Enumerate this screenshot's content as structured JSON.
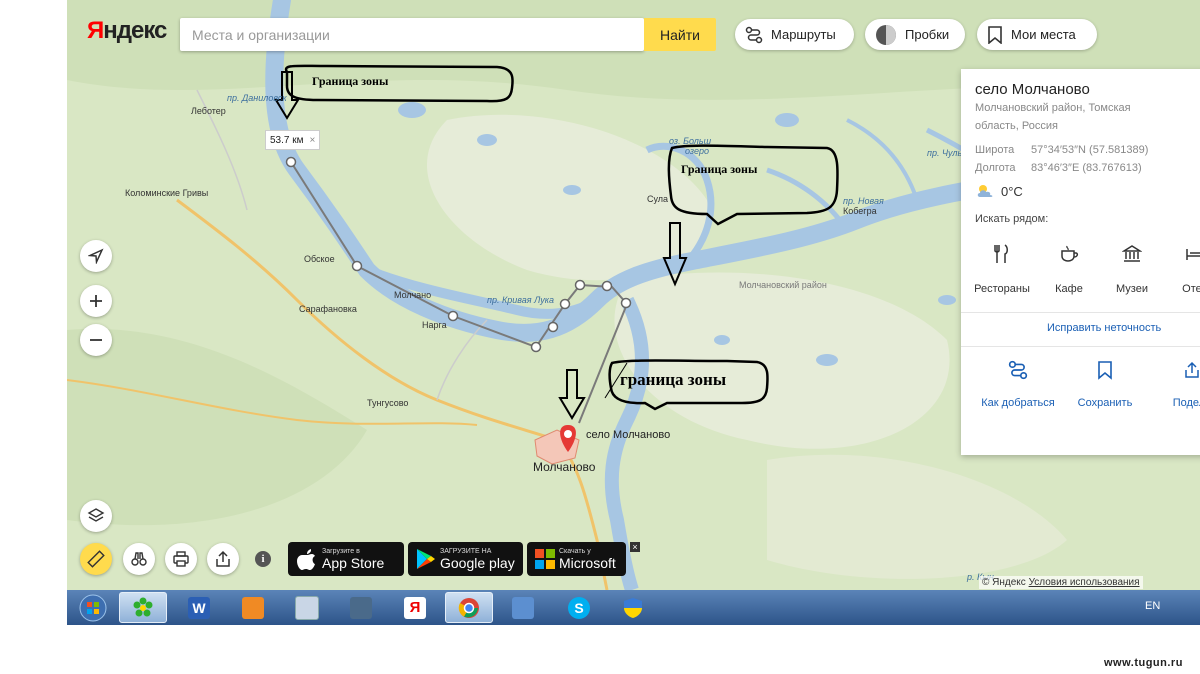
{
  "brand": {
    "logo_first": "Я",
    "logo_rest": "ндекс"
  },
  "search": {
    "placeholder": "Места и организации",
    "find_label": "Найти"
  },
  "top_buttons": {
    "routes": "Маршруты",
    "traffic": "Пробки",
    "my_places": "Мои места"
  },
  "place_card": {
    "title": "село Молчаново",
    "address": "Молчановский район, Томская область, Россия",
    "latitude_label": "Широта",
    "latitude_value": "57°34′53″N (57.581389)",
    "longitude_label": "Долгота",
    "longitude_value": "83°46′3″E (83.767613)",
    "weather": "0°C",
    "nearby_label": "Искать рядом:",
    "categories": [
      "Рестораны",
      "Кафе",
      "Музеи",
      "Отел"
    ],
    "fix_link": "Исправить неточность",
    "actions": [
      "Как добраться",
      "Сохранить",
      "Подели"
    ]
  },
  "map": {
    "distance_label": "53.7 км",
    "place_pin_label": "село Молчаново",
    "labels": {
      "lebotter": "Леботер",
      "kolominskie": "Коломинские Гривы",
      "obskoe": "Обское",
      "molchanovo_small": "Молчано",
      "narga": "Нарга",
      "sarafanovka": "Сарафановка",
      "tungusovo": "Тунгусово",
      "molchanovo_town": "Молчаново",
      "krivaya_luka": "пр. Кривая Лука",
      "danilovskaya": "пр. Даниловск",
      "oz_bolshoe": "оз. Больш",
      "ozero": "озеро",
      "sula": "Сула",
      "novaya": "пр. Новая",
      "kobergra": "Кобегра",
      "chuly": "пр. Чулы",
      "district": "Молчановский район",
      "kyn": "р. Кын"
    }
  },
  "annotations": {
    "zone_top_left": "Граница зоны",
    "zone_top_right": "Граница зоны",
    "zone_bottom": "граница зоны"
  },
  "stores": {
    "appstore_small": "Загрузите в",
    "appstore_big": "App Store",
    "googleplay_small": "ЗАГРУЗИТЕ НА",
    "googleplay_big": "Google play",
    "microsoft_small": "Скачать у",
    "microsoft_big": "Microsoft"
  },
  "copyright": {
    "text": "© Яндекс",
    "terms": "Условия использования"
  },
  "taskbar": {
    "lang": "EN"
  },
  "watermark": "www.tugun.ru",
  "colors": {
    "yellow": "#ffdb4d",
    "river": "#a7c6e3",
    "road": "#f0c36a",
    "link": "#1a5fb4",
    "pin": "#e53935"
  }
}
